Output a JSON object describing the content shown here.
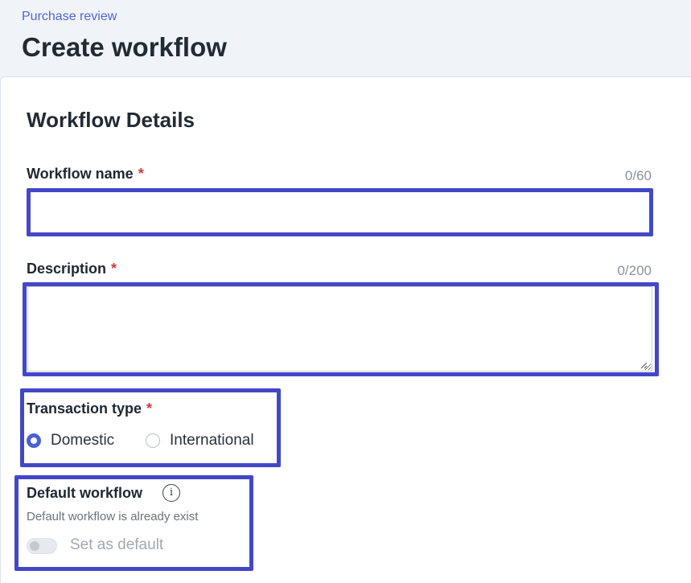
{
  "header": {
    "breadcrumb": "Purchase review",
    "title": "Create workflow"
  },
  "form": {
    "section_title": "Workflow Details",
    "required_mark": "*",
    "workflow_name": {
      "label": "Workflow name",
      "value": "",
      "counter": "0/60"
    },
    "description": {
      "label": "Description",
      "value": "",
      "counter": "0/200"
    },
    "transaction_type": {
      "label": "Transaction type",
      "options": [
        {
          "label": "Domestic",
          "selected": true
        },
        {
          "label": "International",
          "selected": false
        }
      ]
    },
    "default_workflow": {
      "label": "Default workflow",
      "info_icon": "i",
      "helper": "Default workflow is already exist",
      "toggle_label": "Set as default",
      "toggle_on": false,
      "disabled": true
    }
  },
  "colors": {
    "accent": "#4a5fd8",
    "highlight": "#4248c8",
    "required": "#d63a3a",
    "breadcrumb": "#5166d6"
  }
}
